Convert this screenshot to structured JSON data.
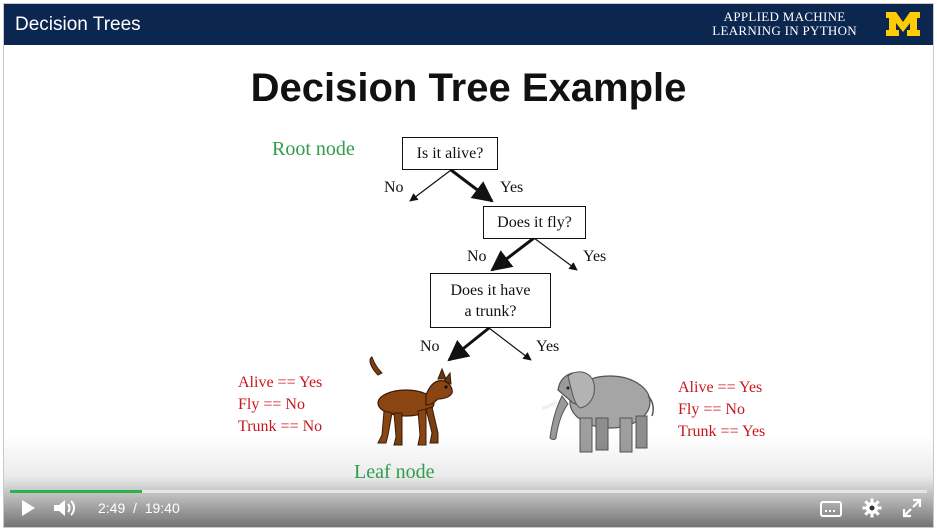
{
  "header": {
    "video_title": "Decision Trees",
    "brand_line1": "APPLIED MACHINE",
    "brand_line2": "LEARNING IN PYTHON",
    "logo_text": "M",
    "logo_color": "#ffcb05"
  },
  "slide": {
    "title": "Decision Tree Example",
    "root_label": "Root node",
    "leaf_label": "Leaf node",
    "nodes": {
      "alive": "Is it alive?",
      "fly": "Does it fly?",
      "trunk_line1": "Does it have",
      "trunk_line2": "a trunk?"
    },
    "edges": {
      "alive_no": "No",
      "alive_yes": "Yes",
      "fly_no": "No",
      "fly_yes": "Yes",
      "trunk_no": "No",
      "trunk_yes": "Yes"
    },
    "dog_facts": [
      "Alive == Yes",
      "Fly == No",
      "Trunk == No"
    ],
    "elephant_facts": [
      "Alive == Yes",
      "Fly == No",
      "Trunk == Yes"
    ]
  },
  "player": {
    "current_time": "2:49",
    "separator": "/",
    "duration": "19:40",
    "progress_fraction": 0.144,
    "accent": "#2bb24c"
  }
}
